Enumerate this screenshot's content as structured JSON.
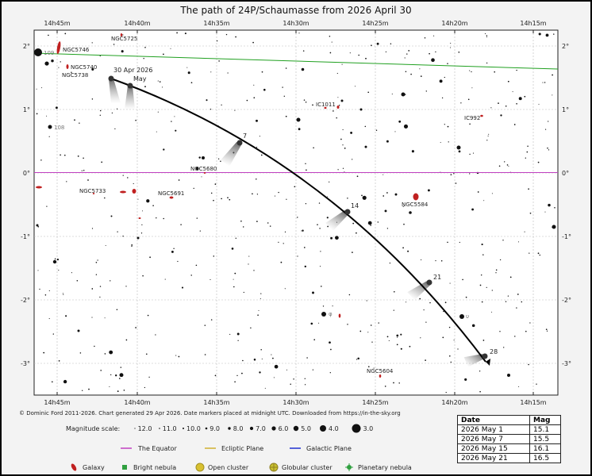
{
  "title": "The path of 24P/Schaumasse from 2026 April 30",
  "ra_labels": [
    "14h45m",
    "14h40m",
    "14h35m",
    "14h30m",
    "14h25m",
    "14h20m",
    "14h15m"
  ],
  "dec_labels": [
    "2°",
    "1°",
    "0°",
    "-1°",
    "-2°",
    "-3°"
  ],
  "credit": "© Dominic Ford 2011-2026. Chart generated 29 Apr 2026. Date markers placed at midnight UTC. Downloaded from https://in-the-sky.org",
  "magnitude_scale": {
    "label": "Magnitude scale:",
    "values": [
      "12.0",
      "11.0",
      "10.0",
      "9.0",
      "8.0",
      "7.0",
      "6.0",
      "5.0",
      "4.0",
      "3.0"
    ]
  },
  "legend_lines": [
    {
      "label": "The Equator",
      "color": "#c040c0"
    },
    {
      "label": "Ecliptic Plane",
      "color": "#d0b030"
    },
    {
      "label": "Galactic Plane",
      "color": "#2030d0"
    }
  ],
  "legend_objects": [
    {
      "label": "Galaxy",
      "icon": "galaxy-icon",
      "color": "#c02020"
    },
    {
      "label": "Bright nebula",
      "icon": "bright-nebula-icon",
      "color": "#30a040"
    },
    {
      "label": "Open cluster",
      "icon": "open-cluster-icon",
      "color": "#d8c030"
    },
    {
      "label": "Globular cluster",
      "icon": "globular-cluster-icon",
      "color": "#c8c030"
    },
    {
      "label": "Planetary nebula",
      "icon": "planetary-nebula-icon",
      "color": "#30a040"
    }
  ],
  "path_markers": {
    "start": [
      "30 Apr 2026",
      "May"
    ],
    "days": [
      "7",
      "14",
      "21",
      "28"
    ]
  },
  "objects": [
    {
      "label": "NGC5746",
      "kind": "galaxy"
    },
    {
      "label": "NGC5725",
      "kind": "galaxy"
    },
    {
      "label": "NGC5740",
      "kind": "galaxy"
    },
    {
      "label": "NGC5738",
      "kind": "galaxy"
    },
    {
      "label": "IC1011",
      "kind": "galaxy"
    },
    {
      "label": "IC992",
      "kind": "galaxy"
    },
    {
      "label": "NGC5680",
      "kind": "galaxy"
    },
    {
      "label": "NGC5733",
      "kind": "galaxy"
    },
    {
      "label": "NGC5691",
      "kind": "galaxy"
    },
    {
      "label": "NGC5584",
      "kind": "galaxy"
    },
    {
      "label": "NGC5604",
      "kind": "galaxy"
    }
  ],
  "star_labels": [
    "109",
    "108",
    "φ",
    "υ"
  ],
  "mag_table": {
    "headers": [
      "Date",
      "Mag"
    ],
    "rows": [
      [
        "2026 May 1",
        "15.1"
      ],
      [
        "2026 May 7",
        "15.5"
      ],
      [
        "2026 May 15",
        "16.1"
      ],
      [
        "2026 May 21",
        "16.5"
      ]
    ]
  },
  "colors": {
    "equator": "#c040c0",
    "galactic_plane": "#20a020",
    "path": "#000000",
    "galaxy": "#c02020",
    "background": "#ffffff",
    "frame": "#f3f3f3"
  }
}
